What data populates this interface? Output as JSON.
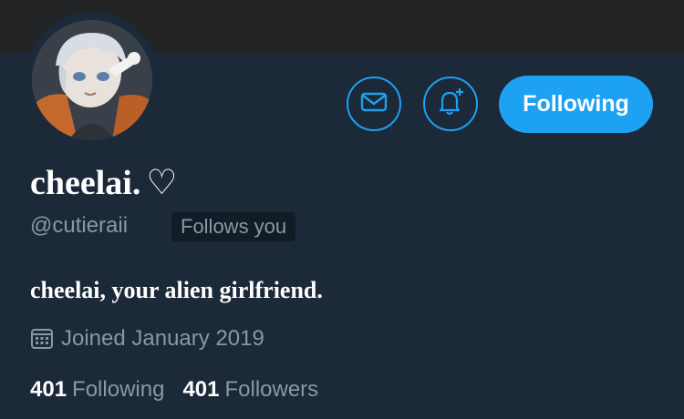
{
  "colors": {
    "background": "#1c2938",
    "banner": "#222325",
    "accent": "#1da1f2",
    "secondary_text": "#8899a6",
    "badge_bg": "#121c26"
  },
  "header": {
    "avatar_icon": "avatar"
  },
  "actions": {
    "message_icon": "mail-icon",
    "notify_icon": "bell-plus-icon",
    "follow_label": "Following"
  },
  "profile": {
    "display_name": "cheelai.",
    "name_heart": "♡",
    "handle": "@cutieraii",
    "follows_you": "Follows you",
    "bio": "cheelai, your alien girlfriend.",
    "joined_icon": "calendar-icon",
    "joined": "Joined January 2019"
  },
  "stats": {
    "following_count": "401",
    "following_label": "Following",
    "followers_count": "401",
    "followers_label": "Followers"
  }
}
